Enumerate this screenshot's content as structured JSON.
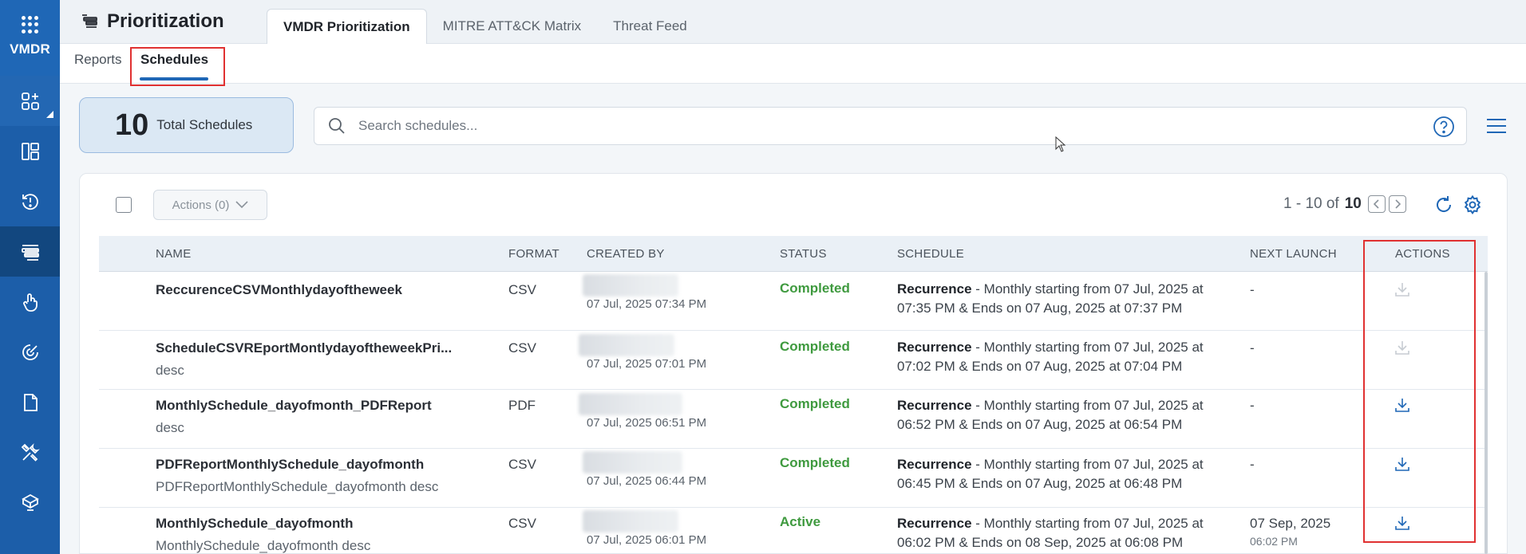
{
  "rail": {
    "app_label": "VMDR"
  },
  "header": {
    "title": "Prioritization",
    "tabs": [
      "VMDR Prioritization",
      "MITRE ATT&CK Matrix",
      "Threat Feed"
    ]
  },
  "subtabs": [
    "Reports",
    "Schedules"
  ],
  "summary": {
    "total": "10",
    "total_label": "Total Schedules"
  },
  "search": {
    "placeholder": "Search schedules..."
  },
  "toolbar": {
    "actions_label": "Actions (0)",
    "range": "1 - 10 of",
    "count": "10"
  },
  "table": {
    "columns": [
      "NAME",
      "FORMAT",
      "CREATED BY",
      "STATUS",
      "SCHEDULE",
      "NEXT LAUNCH",
      "ACTIONS"
    ],
    "rows": [
      {
        "name": "ReccurenceCSVMonthlydayoftheweek",
        "desc": "",
        "format": "CSV",
        "created": "07 Jul, 2025 07:34 PM",
        "status": "Completed",
        "schedule_label": "Recurrence",
        "schedule_text": " - Monthly starting from 07 Jul, 2025 at 07:35 PM & Ends on 07 Aug, 2025 at 07:37 PM",
        "next": "-",
        "next_time": ""
      },
      {
        "name": "ScheduleCSVREportMontlydayoftheweekPri...",
        "desc": "desc",
        "format": "CSV",
        "created": "07 Jul, 2025 07:01 PM",
        "status": "Completed",
        "schedule_label": "Recurrence",
        "schedule_text": " - Monthly starting from 07 Jul, 2025 at 07:02 PM & Ends on 07 Aug, 2025 at 07:04 PM",
        "next": "-",
        "next_time": ""
      },
      {
        "name": "MonthlySchedule_dayofmonth_PDFReport",
        "desc": "desc",
        "format": "PDF",
        "created": "07 Jul, 2025 06:51 PM",
        "status": "Completed",
        "schedule_label": "Recurrence",
        "schedule_text": " - Monthly starting from 07 Jul, 2025 at 06:52 PM & Ends on 07 Aug, 2025 at 06:54 PM",
        "next": "-",
        "next_time": ""
      },
      {
        "name": "PDFReportMonthlySchedule_dayofmonth",
        "desc": "PDFReportMonthlySchedule_dayofmonth desc",
        "format": "CSV",
        "created": "07 Jul, 2025 06:44 PM",
        "status": "Completed",
        "schedule_label": "Recurrence",
        "schedule_text": " - Monthly starting from 07 Jul, 2025 at 06:45 PM & Ends on 07 Aug, 2025 at 06:48 PM",
        "next": "-",
        "next_time": ""
      },
      {
        "name": "MonthlySchedule_dayofmonth",
        "desc": "MonthlySchedule_dayofmonth desc",
        "format": "CSV",
        "created": "07 Jul, 2025 06:01 PM",
        "status": "Active",
        "schedule_label": "Recurrence",
        "schedule_text": " - Monthly starting from 07 Jul, 2025 at 06:02 PM & Ends on 08 Sep, 2025 at 06:08 PM",
        "next": "07 Sep, 2025",
        "next_time": "06:02 PM"
      }
    ]
  },
  "colors": {
    "rail": "#1c5ea9",
    "accent": "#1f67b6",
    "status_green": "#3f9a3f",
    "highlight": "#e03131"
  }
}
